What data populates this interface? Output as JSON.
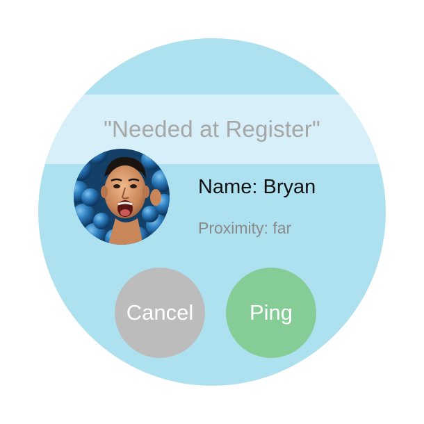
{
  "notification": {
    "message": "\"Needed at Register\""
  },
  "contact": {
    "avatar_icon": "person-photo",
    "name": "Name: Bryan",
    "proximity": "Proximity: far"
  },
  "actions": {
    "cancel_label": "Cancel",
    "ping_label": "Ping"
  },
  "colors": {
    "face_background": "#ade1f0",
    "message_band": "#d6eff8",
    "message_text": "#a6a6a6",
    "cancel_button": "#bcbcbc",
    "ping_button": "#86cc97"
  }
}
